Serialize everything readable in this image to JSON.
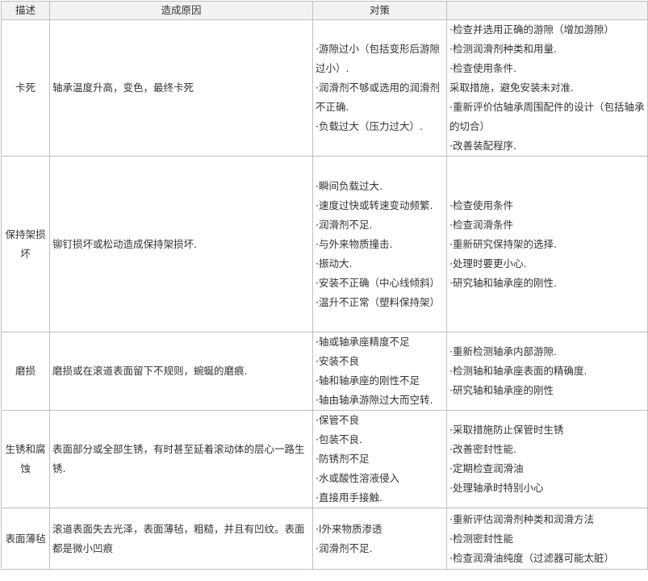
{
  "headers": [
    "描述",
    "造成原因",
    "对策",
    ""
  ],
  "rows": [
    {
      "desc": "卡死",
      "cause": "轴承温度升高，变色，最终卡死",
      "countermeasures": [
        "·游隙过小（包括变形后游隙过小）.",
        "·润滑剂不够或选用的润滑剂不正确.",
        "·负载过大（压力过大）."
      ],
      "extra": [
        "·检查并选用正确的游隙（增加游隙）",
        "·检测润滑剂种类和用量.",
        "·检查使用条件.",
        "采取措施，避免安装未对准.",
        "·重新评价估轴承周围配件的设计（包括轴承的切合）",
        "·改善装配程序."
      ]
    },
    {
      "desc": "保持架损坏",
      "cause": "铆钉损坏或松动造成保持架损坏.",
      "countermeasures": [
        "·瞬间负载过大.",
        "·速度过快或转速变动频繁.",
        "·润滑剂不足.",
        "·与外来物质撞击.",
        "·振动大.",
        "·安装不正确（中心线倾斜）",
        "·温升不正常（塑料保持架）"
      ],
      "extra": [
        "·检查使用条件",
        "·检查润滑条件",
        "·重新研究保持架的选择.",
        "·处理时要更小心.",
        "·研究轴和轴承座的刚性."
      ]
    },
    {
      "desc": "磨损",
      "cause": "磨损或在滚道表面留下不规则，蜿蜒的磨痕.",
      "countermeasures": [
        "·轴或轴承座精度不足",
        "·安装不良",
        "·轴和轴承座的刚性不足",
        "·轴由轴承游隙过大而空转."
      ],
      "extra": [
        "·重新检测轴承内部游隙.",
        "·检测轴和轴承座表面的精确度.",
        "·研究轴和轴承座的刚性"
      ]
    },
    {
      "desc": "生锈和腐蚀",
      "cause": "表面部分或全部生锈，有时甚至延着滚动体的层心一路生锈.",
      "countermeasures": [
        "·保管不良",
        "·包装不良.",
        "·防锈剂不足",
        "·水或酸性溶液侵入",
        "·直接用手接触."
      ],
      "extra": [
        "·采取措施防止保管时生锈",
        "·改善密封性能.",
        "·定期检查润滑油",
        "·处理轴承时特别小心"
      ]
    },
    {
      "desc": "表面薄毡",
      "cause": "滚道表面失去光泽，表面薄毡，粗糙，并且有凹纹。表面都是微小凹痕",
      "countermeasures": [
        "·l外来物质渗透",
        "·润滑剂不足."
      ],
      "extra": [
        "·重新评估润滑剂种类和润滑方法",
        "·检测密封性能",
        "·检查润滑油纯度（过滤器可能太脏）"
      ]
    }
  ]
}
